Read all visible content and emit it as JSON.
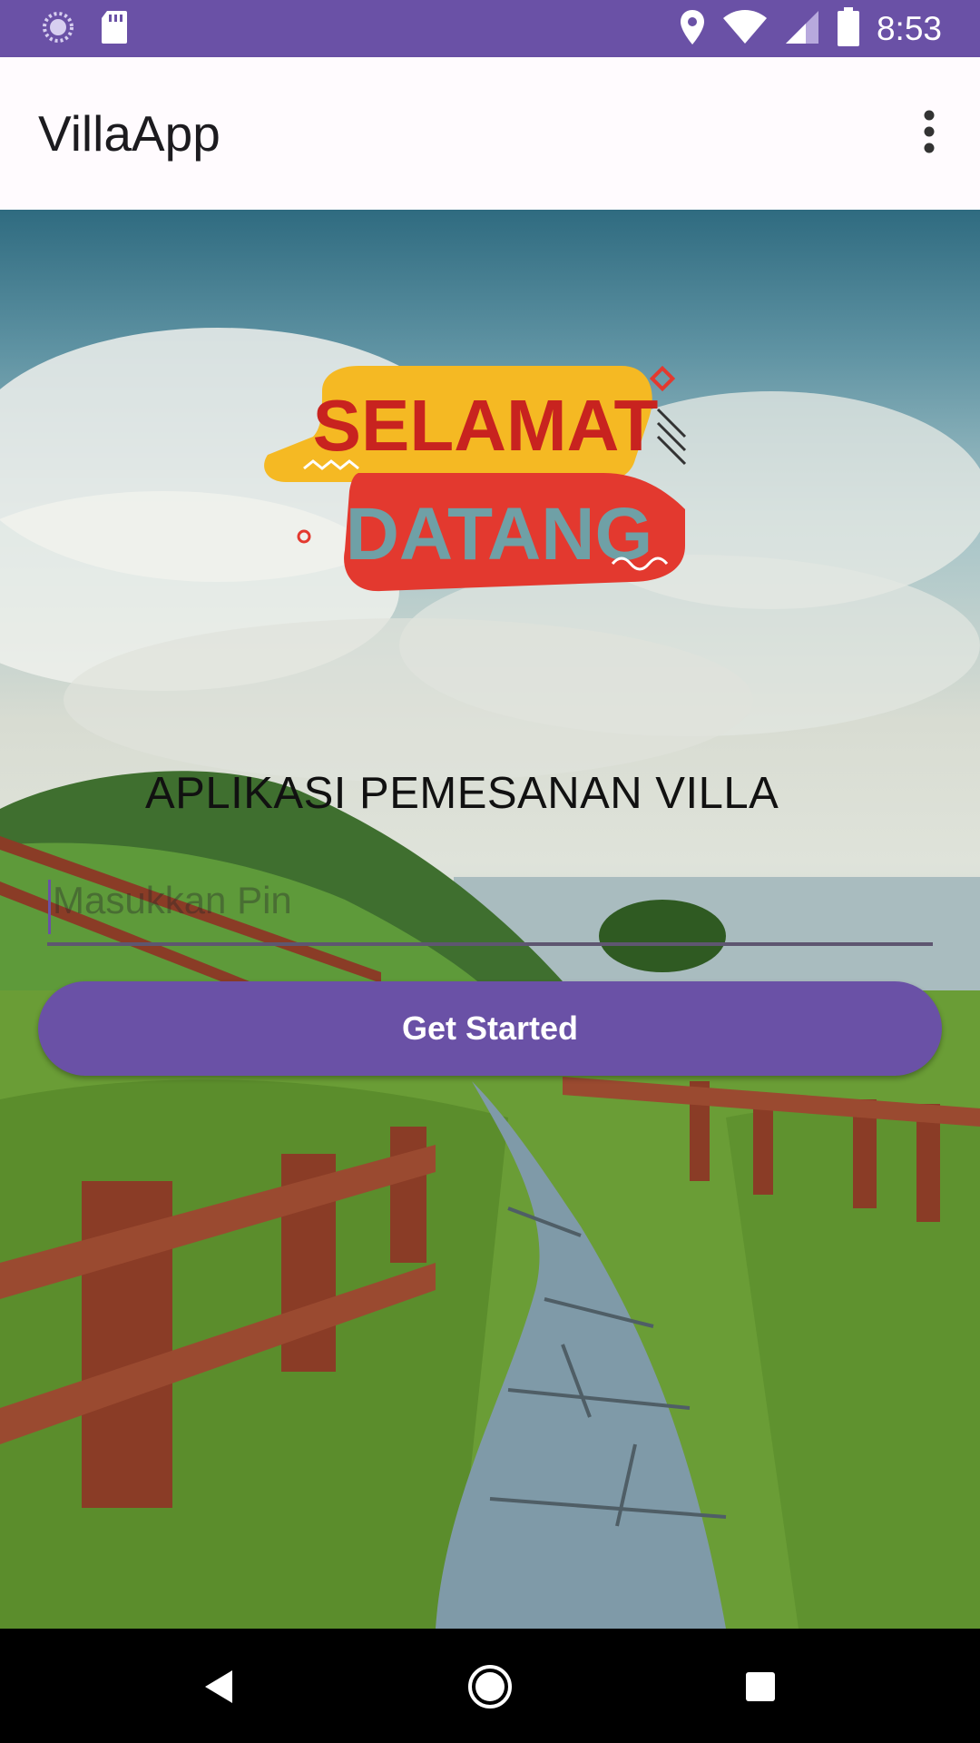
{
  "status_bar": {
    "time": "8:53",
    "left_icons": [
      "sync-icon",
      "sd-card-icon"
    ],
    "right_icons": [
      "location-icon",
      "wifi-icon",
      "signal-icon",
      "battery-icon"
    ],
    "color": "#6a51a6"
  },
  "app_bar": {
    "title": "VillaApp",
    "overflow_icon": "more-vert-icon"
  },
  "main": {
    "logo": {
      "line1": "SELAMAT",
      "line2": "DATANG"
    },
    "tagline": "APLIKASI PEMESANAN VILLA",
    "pin_input": {
      "placeholder": "Masukkan Pin",
      "value": ""
    },
    "get_started_label": "Get Started",
    "accent_color": "#6a51a6"
  },
  "nav_bar": {
    "buttons": [
      "back-icon",
      "home-icon",
      "recents-icon"
    ]
  }
}
